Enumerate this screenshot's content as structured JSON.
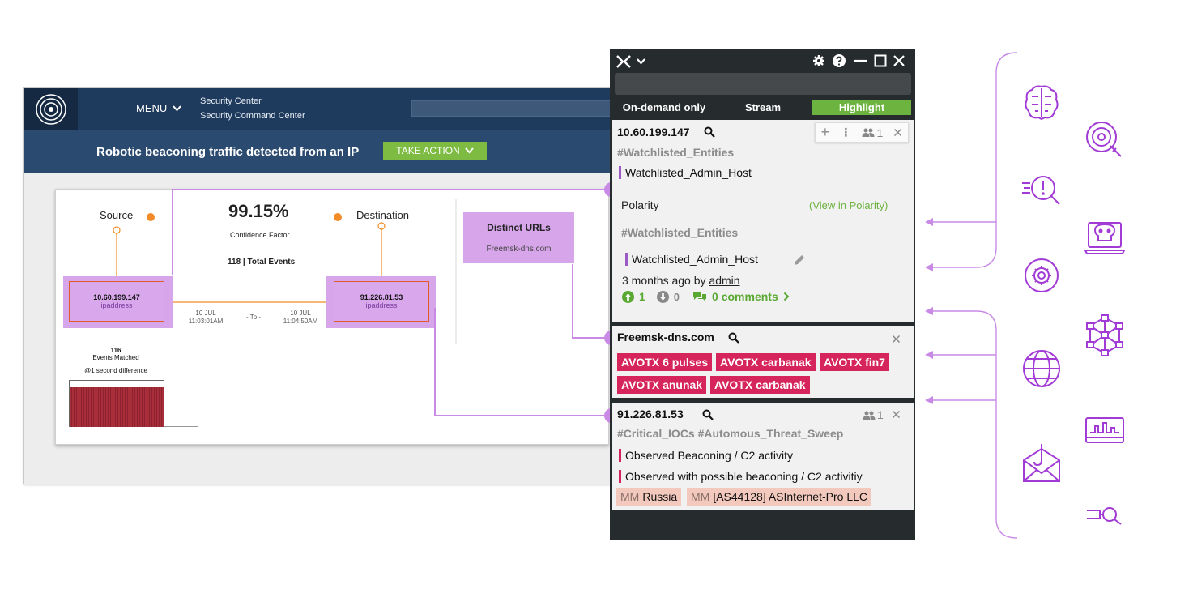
{
  "app": {
    "menu_label": "MENU",
    "brand_line1": "Security Center",
    "brand_line2": "Security Command Center",
    "alert_title": "Robotic beaconing traffic detected from an IP",
    "take_action_label": "TAKE ACTION"
  },
  "graph": {
    "source_label": "Source",
    "destination_label": "Destination",
    "confidence_value": "99.15%",
    "confidence_label": "Confidence Factor",
    "total_events": "118 | Total Events",
    "source_ip": "10.60.199.147",
    "source_type": "ipaddress",
    "dest_ip": "91.226.81.53",
    "dest_type": "ipaddress",
    "time_start_date": "10  JUL",
    "time_start": "11:03:01AM",
    "time_to": "- To -",
    "time_end_date": "10  JUL",
    "time_end": "11:04:50AM",
    "events_matched_count": "116",
    "events_matched_label": "Events Matched",
    "difference_label": "@1 second difference",
    "distinct_urls_title": "Distinct URLs",
    "distinct_urls_value": "Freemsk-dns.com"
  },
  "panel": {
    "tabs": [
      {
        "label": "On-demand only",
        "selected": false
      },
      {
        "label": "Stream",
        "selected": false
      },
      {
        "label": "Highlight",
        "selected": true
      }
    ],
    "card1": {
      "entity": "10.60.199.147",
      "user_count": "1",
      "tag_header": "#Watchlisted_Entities",
      "tag_value": "Watchlisted_Admin_Host",
      "integration": "Polarity",
      "view_link": "(View in Polarity)",
      "tag_header2": "#Watchlisted_Entities",
      "tag_value2": "Watchlisted_Admin_Host",
      "time_ago": "3 months ago by",
      "author": "admin",
      "upvotes": "1",
      "downvotes": "0",
      "comments": "0 comments"
    },
    "card2": {
      "entity": "Freemsk-dns.com",
      "tags": [
        "AVOTX 6 pulses",
        "AVOTX carbanak",
        "AVOTX fin7",
        "AVOTX anunak",
        "AVOTX carbanak"
      ]
    },
    "card3": {
      "entity": "91.226.81.53",
      "user_count": "1",
      "tag_header": "#Critical_IOCs #Automous_Threat_Sweep",
      "line1": "Observed Beaconing / C2 activity",
      "line2": "Observed with possible beaconing / C2 activitiy",
      "mm_prefix": "MM",
      "geo": "Russia",
      "asn": "[AS44128] ASInternet-Pro LLC"
    }
  },
  "colors": {
    "accent_purple": "#a23bd6",
    "highlight_green": "#6cb33f",
    "avotx_red": "#d6245d",
    "app_navy": "#1e3a5c"
  }
}
